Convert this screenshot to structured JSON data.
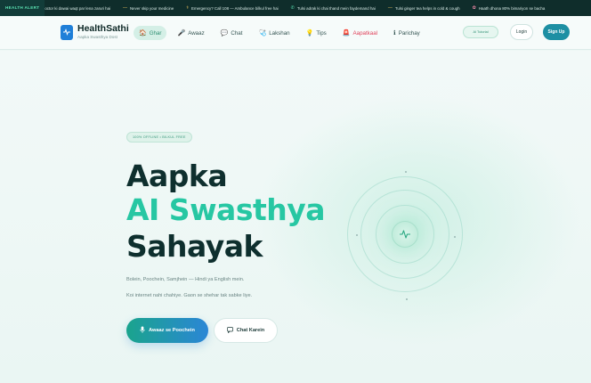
{
  "ticker": {
    "tag": "HEALTH ALERT",
    "items": [
      {
        "icon": "",
        "text": "octor ki dawai waqt par lena zaruri hai"
      },
      {
        "icon": "—",
        "text": "Never skip your medicine"
      },
      {
        "icon": "⚕",
        "text": "Emergency? Call 108 — Ambulance bilkul free hai"
      },
      {
        "icon": "✆",
        "text": "Tulsi adrak ki chai thand mein faydemand hai"
      },
      {
        "icon": "—",
        "text": "Tulsi ginger tea helps in cold & cough"
      },
      {
        "icon": "✿",
        "text": "Haath dhona 80% bimariyon se bacha"
      }
    ]
  },
  "brand": {
    "name": "HealthSathi",
    "subtitle": "Aapka Swasthya Dost"
  },
  "nav": {
    "items": [
      {
        "icon": "home-icon",
        "glyph": "🏠",
        "label": "Ghar"
      },
      {
        "icon": "mic-icon",
        "glyph": "🎤",
        "label": "Awaaz"
      },
      {
        "icon": "chat-icon",
        "glyph": "💬",
        "label": "Chat"
      },
      {
        "icon": "stethoscope-icon",
        "glyph": "🩺",
        "label": "Lakshan"
      },
      {
        "icon": "bulb-icon",
        "glyph": "💡",
        "label": "Tips"
      },
      {
        "icon": "emergency-icon",
        "glyph": "🚨",
        "label": "Aapatkaal"
      },
      {
        "icon": "info-icon",
        "glyph": "ℹ",
        "label": "Parichay"
      }
    ],
    "ai_pill": "AI Tutorial",
    "login": "Login",
    "signup": "Sign Up"
  },
  "hero": {
    "badge": "100% OFFLINE • BILKUL FREE",
    "line1": "Aapka",
    "line2": "AI Swasthya",
    "line3": "Sahayak",
    "sub1": "Bolein, Poochein, Samjhein — Hindi ya English mein.",
    "sub2": "Koi internet nahi chahiye. Gaon se shehar tak sabke liye.",
    "cta_voice": "Awaaz se Poochein",
    "cta_chat": "Chat Karein"
  },
  "colors": {
    "accent": "#27c7a3",
    "primary_dark": "#0e2f2e",
    "ticker_bg": "#0f2d2b",
    "alert": "#e0425b",
    "brand_blue": "#1f7fd8"
  }
}
